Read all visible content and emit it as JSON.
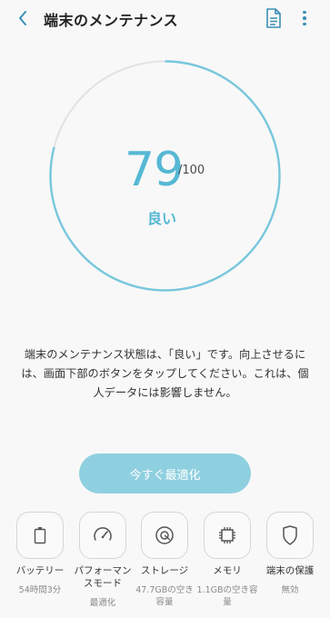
{
  "header": {
    "title": "端末のメンテナンス"
  },
  "score": {
    "value": "79",
    "max": "/100",
    "status": "良い",
    "fraction": 0.79,
    "accent": "#55b8d4"
  },
  "description": "端末のメンテナンス状態は、「良い」です。向上させるには、画面下部のボタンをタップしてください。これは、個人データには影響しません。",
  "optimize_button": {
    "label": "今すぐ最適化"
  },
  "items": [
    {
      "icon": "battery-icon",
      "label": "バッテリー",
      "sub": "54時間3分"
    },
    {
      "icon": "gauge-icon",
      "label": "パフォーマンスモード",
      "sub": "最適化"
    },
    {
      "icon": "storage-icon",
      "label": "ストレージ",
      "sub": "47.7GBの空き容量"
    },
    {
      "icon": "memory-chip-icon",
      "label": "メモリ",
      "sub": "1.1GBの空き容量"
    },
    {
      "icon": "shield-icon",
      "label": "端末の保護",
      "sub": "無効"
    }
  ]
}
